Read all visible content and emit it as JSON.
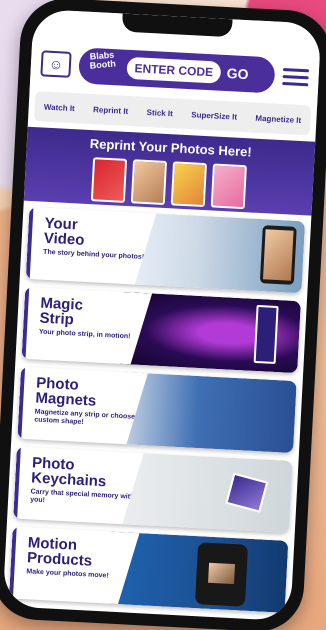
{
  "header": {
    "logo_text": "Blabs Booth",
    "code_placeholder": "ENTER CODE",
    "go_label": "GO"
  },
  "nav": {
    "items": [
      "Watch It",
      "Reprint It",
      "Stick It",
      "SuperSize It",
      "Magnetize It"
    ]
  },
  "banner": {
    "title": "Reprint Your Photos Here!"
  },
  "products": [
    {
      "title_line1": "Your",
      "title_line2": "Video",
      "subtitle": "The story behind your photos!"
    },
    {
      "title_line1": "Magic",
      "title_line2": "Strip",
      "subtitle": "Your photo strip, in motion!"
    },
    {
      "title_line1": "Photo",
      "title_line2": "Magnets",
      "subtitle": "Magnetize any strip or choose a custom shape!"
    },
    {
      "title_line1": "Photo",
      "title_line2": "Keychains",
      "subtitle": "Carry that special memory with you!"
    },
    {
      "title_line1": "Motion",
      "title_line2": "Products",
      "subtitle": "Make your photos move!"
    }
  ],
  "icons": {
    "account": "account-icon",
    "menu": "hamburger-menu-icon"
  },
  "colors": {
    "brand_purple": "#4a2f9c",
    "brand_dark": "#2b1f77"
  }
}
